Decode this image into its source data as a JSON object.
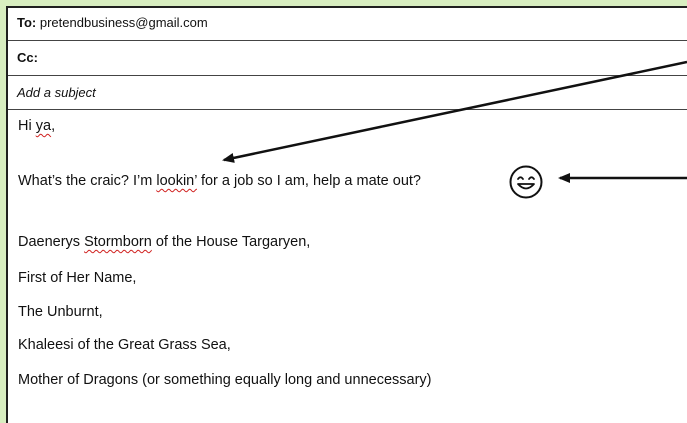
{
  "header": {
    "to_label": "To:",
    "to_value": "pretendbusiness@gmail.com",
    "cc_label": "Cc:",
    "cc_value": "",
    "subject_placeholder": "Add a subject"
  },
  "body": {
    "greeting_word": "Hi ",
    "greeting_name": "ya",
    "greeting_punct": ",",
    "line2_a": "What’s the craic? I’m ",
    "line2_misspelled": "lookin’",
    "line2_b": " for a job so I am, help a mate out?",
    "sig1_a": "Daenerys ",
    "sig1_misspelled": "Stormborn",
    "sig1_b": " of the House Targaryen,",
    "sig2": "First of Her Name,",
    "sig3": "The Unburnt,",
    "sig4": "Khaleesi of the Great Grass Sea,",
    "sig5": "Mother of Dragons (or something equally long and unnecessary)"
  },
  "icons": {
    "emoji": "smiling-face-icon",
    "arrows": [
      "annotation-arrow-to-lookin",
      "annotation-arrow-to-emoji"
    ]
  },
  "colors": {
    "background_green": "#d8eec0",
    "spellcheck_red": "#d0201e",
    "text": "#111111"
  }
}
